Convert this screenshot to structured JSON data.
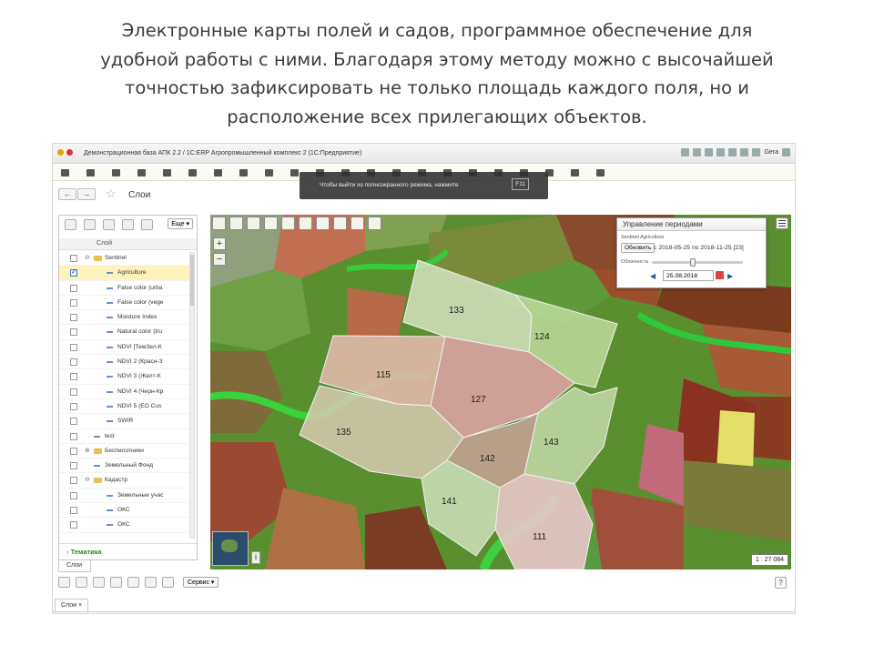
{
  "heading_lines": [
    "Электронные карты полей и садов, программное обеспечение для",
    "удобной работы с ними. Благодаря этому методу можно с высочайшей",
    "точностью зафиксировать не только площадь каждого поля, но и",
    "расположение всех прилегающих объектов."
  ],
  "window": {
    "title": "Демонстрационная база АПК 2.2 / 1С:ERP Агропромышленный комплекс 2  (1С:Предприятие)",
    "user": "Gera"
  },
  "page": {
    "title": "Слои",
    "back_glyph": "←",
    "forward_glyph": "→",
    "star_glyph": "☆"
  },
  "fullscreen_note": {
    "text": "Чтобы выйти из полноэкранного режима, нажмите",
    "key": "F11"
  },
  "layers_panel": {
    "more_label": "Еще ▾",
    "column_header": "Слой",
    "items": [
      {
        "label": "Sentinel",
        "checked": false,
        "kind": "folder",
        "level": 0,
        "selected": false
      },
      {
        "label": "Agriculture",
        "checked": true,
        "kind": "layer",
        "level": 1,
        "selected": true
      },
      {
        "label": "False color (urba",
        "checked": false,
        "kind": "layer",
        "level": 1,
        "selected": false
      },
      {
        "label": "False color (vege",
        "checked": false,
        "kind": "layer",
        "level": 1,
        "selected": false
      },
      {
        "label": "Moisture Index",
        "checked": false,
        "kind": "layer",
        "level": 1,
        "selected": false
      },
      {
        "label": "Natural color (tru",
        "checked": false,
        "kind": "layer",
        "level": 1,
        "selected": false
      },
      {
        "label": "NDVI [ТемЗел-К",
        "checked": false,
        "kind": "layer",
        "level": 1,
        "selected": false
      },
      {
        "label": "NDVI 2 (Красн-З",
        "checked": false,
        "kind": "layer",
        "level": 1,
        "selected": false
      },
      {
        "label": "NDVI 3 (Желт-К",
        "checked": false,
        "kind": "layer",
        "level": 1,
        "selected": false
      },
      {
        "label": "NDVI 4 (Черн-Кр",
        "checked": false,
        "kind": "layer",
        "level": 1,
        "selected": false
      },
      {
        "label": "NDVI 5 (EO Cus",
        "checked": false,
        "kind": "layer",
        "level": 1,
        "selected": false
      },
      {
        "label": "SWIR",
        "checked": false,
        "kind": "layer",
        "level": 1,
        "selected": false
      },
      {
        "label": "test",
        "checked": false,
        "kind": "layer",
        "level": 0,
        "selected": false
      },
      {
        "label": "Беспилотники",
        "checked": false,
        "kind": "folder-collapsed",
        "level": 0,
        "selected": false
      },
      {
        "label": "Земельный Фонд",
        "checked": false,
        "kind": "layer",
        "level": 0,
        "selected": false
      },
      {
        "label": "Кадастр",
        "checked": false,
        "kind": "folder",
        "level": 0,
        "selected": false
      },
      {
        "label": "Земельные учас",
        "checked": false,
        "kind": "layer",
        "level": 1,
        "selected": false
      },
      {
        "label": "ОКС",
        "checked": false,
        "kind": "layer",
        "level": 1,
        "selected": false
      },
      {
        "label": "ОКС",
        "checked": false,
        "kind": "layer",
        "level": 1,
        "selected": false
      }
    ],
    "tematika_label": "Тематика",
    "tab_label": "Слои"
  },
  "map": {
    "zoom_in": "+",
    "zoom_out": "−",
    "info_glyph": "i",
    "scale": "1 : 27 084",
    "fields": [
      "133",
      "124",
      "115",
      "127",
      "135",
      "142",
      "143",
      "141",
      "111"
    ]
  },
  "periods_panel": {
    "title": "Управление периодами",
    "subtitle": "Sentinel Agriculture",
    "update_label": "Обновить",
    "range_text": "с 2018-05-25 по 2018-11-25 [23]",
    "clarity_label": "Облачность",
    "date_value": "25.08.2018",
    "prev_glyph": "◀",
    "next_glyph": "▶"
  },
  "bottom": {
    "service_label": "Сервис ▾",
    "help_glyph": "?",
    "tab_label": "Слои ×"
  }
}
